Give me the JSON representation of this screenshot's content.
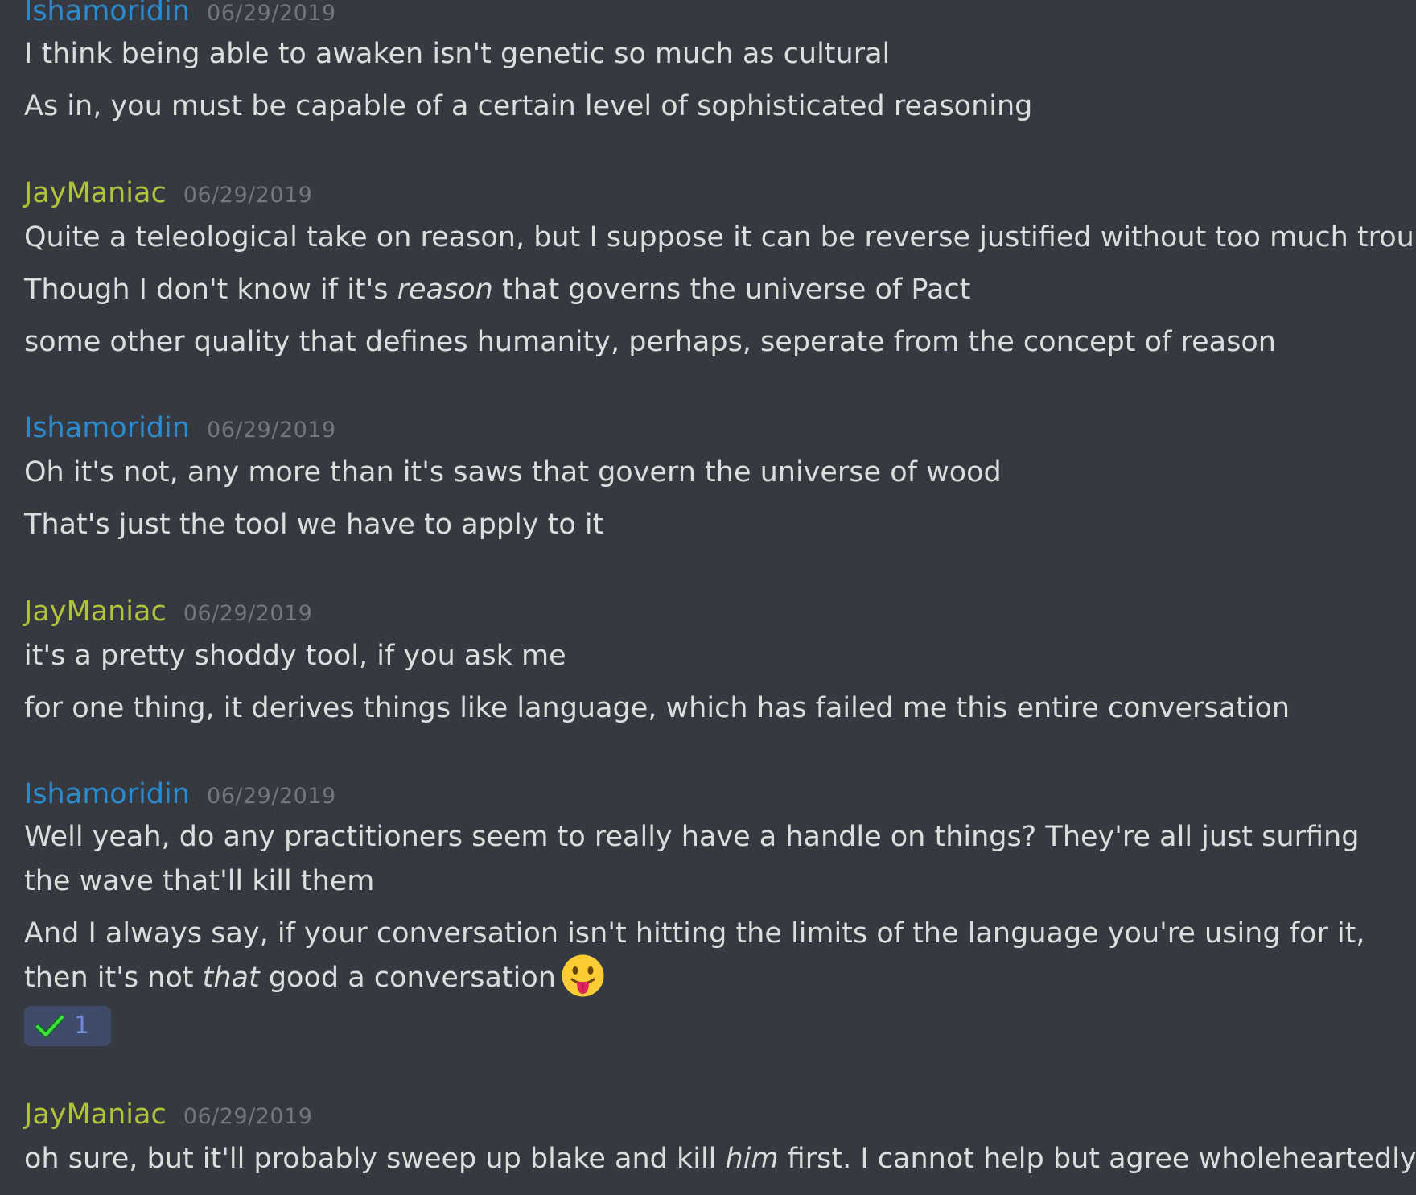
{
  "colors": {
    "background": "#36393f",
    "ishamoridin": "#2b8bd0",
    "jaymaniac": "#b0c43a",
    "message_text": "#dcddde",
    "timestamp": "#72767d",
    "reaction_bg": "#404a6b",
    "reaction_count": "#7289da"
  },
  "groups": [
    {
      "author": "Ishamoridin",
      "timestamp": "06/29/2019",
      "lines": [
        "I think being able to awaken isn't genetic so much as cultural",
        "As in, you must be capable of a certain level of sophisticated reasoning"
      ]
    },
    {
      "author": "JayManiac",
      "timestamp": "06/29/2019",
      "lines": [
        "Quite a teleological take on reason, but I suppose it can be reverse justified without too much trouble",
        {
          "before": "Though I don't know if it's ",
          "italic": "reason",
          "after": " that governs the universe of Pact"
        },
        "some other quality that defines humanity, perhaps, seperate from the concept of reason"
      ]
    },
    {
      "author": "Ishamoridin",
      "timestamp": "06/29/2019",
      "lines": [
        "Oh it's not, any more than it's saws that govern the universe of wood",
        "That's just the tool we have to apply to it"
      ]
    },
    {
      "author": "JayManiac",
      "timestamp": "06/29/2019",
      "lines": [
        "it's a pretty shoddy tool, if you ask me",
        "for one thing, it derives things like language, which has failed me this entire conversation"
      ]
    },
    {
      "author": "Ishamoridin",
      "timestamp": "06/29/2019",
      "lines": [
        "Well yeah, do any practitioners seem to really have a handle on things? They're all just surfing the wave that'll kill them",
        {
          "before": "And I always say, if your conversation isn't hitting the limits of the language you're using for it, then it's not ",
          "italic": "that",
          "after": " good a conversation",
          "emoji": "stuck-out-tongue-emoji"
        }
      ],
      "reaction": {
        "emoji": "check-mark-emoji",
        "count": "1"
      }
    },
    {
      "author": "JayManiac",
      "timestamp": "06/29/2019",
      "lines": [
        {
          "before": "oh sure, but it'll probably sweep up blake and kill ",
          "italic": "him",
          "after": " first. I cannot help but agree wholeheartedly"
        }
      ]
    }
  ]
}
